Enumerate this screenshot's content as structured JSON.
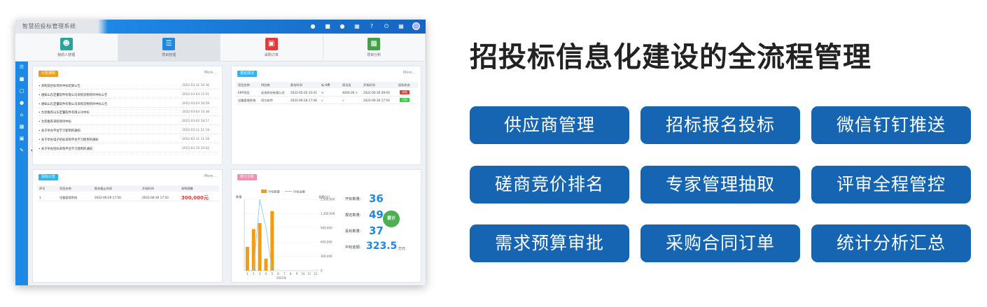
{
  "app": {
    "title": "智慧招投标管理系统",
    "modules": [
      {
        "label": "我的人管理",
        "icon": "user-icon",
        "color": "#26a69a"
      },
      {
        "label": "项目管理",
        "icon": "document-icon",
        "color": "#1e88e5"
      },
      {
        "label": "采购订单",
        "icon": "cart-icon",
        "color": "#e53935"
      },
      {
        "label": "项目分析",
        "icon": "chart-icon",
        "color": "#43a047"
      }
    ],
    "notices": {
      "title": "公告通知",
      "more": "More...",
      "rows": [
        {
          "text": "• 采购及招标项目中标结果公告",
          "date": "2022-03-31 10:36"
        },
        {
          "text": "• 通知山东定量软件有限公司采购货物项目中标公告",
          "date": "2022-03-03 11:01"
        },
        {
          "text": "• 通知山东定量软件有限公司采购货物项目中标公告",
          "date": "2022-03-03 10:59"
        },
        {
          "text": "• 为您推荐山东定量软件有限公司中标",
          "date": "2022-03-03 10:38"
        },
        {
          "text": "• 为您推荐采购项目中标",
          "date": "2022-03-02 18:17"
        },
        {
          "text": "• 关于举办平台学习使用的通知",
          "date": "2022-02-11 11:18"
        },
        {
          "text": "• 关于举办电子招标采购平台学习使用的通知",
          "date": "2022-02-11 11:18"
        },
        {
          "text": "• 关于举办招标采购平台学习使用的通知",
          "date": "2022-02-10 10:02"
        }
      ]
    },
    "bid_status": {
      "title": "报名情况",
      "more": "More...",
      "headers": [
        "项目名称",
        "供应商",
        "报名时间",
        "标书费",
        "保证金",
        "开标时间",
        "投标状态"
      ],
      "rows": [
        {
          "cells": [
            "ERP项目",
            "宏发科技有限公司",
            "2022-05-26 10:41",
            "×",
            "4000.00 ×",
            "2022-06-30 09:00"
          ],
          "status": "未投",
          "status_color": "#e53935"
        },
        {
          "cells": [
            "设备管理系统",
            "同方软件",
            "2022-06-28 17:46",
            "√",
            "√",
            "2022-06-30 17:50"
          ],
          "status": "已投",
          "status_color": "#2ecc40"
        }
      ]
    },
    "tender": {
      "title": "招标公告",
      "more": "More...",
      "headers": [
        "序号",
        "项目名称",
        "报名截止时间",
        "开标时间",
        "采购预算"
      ],
      "row": [
        "1",
        "设备管理系统",
        "2022-06-29 17:50",
        "2022-06-30 17:50",
        "300,000元"
      ]
    },
    "stats": {
      "title": "统计分析",
      "legend_bar": "中标数量",
      "legend_line": "中标金额",
      "y_left_unit": "数量",
      "y_right_unit": "金额(元)",
      "y_right_ticks": [
        "1,500,000",
        "1,200,000",
        "900,000",
        "600,000",
        "300,000",
        "0"
      ],
      "year": "2022年",
      "summary": [
        {
          "label": "开标数量:",
          "value": "36",
          "unit": ""
        },
        {
          "label": "报名数量:",
          "value": "49",
          "unit": ""
        },
        {
          "label": "投标数量:",
          "value": "37",
          "unit": ""
        },
        {
          "label": "中标金额:",
          "value": "323.5",
          "unit": "万元"
        }
      ],
      "total_badge": "累计"
    },
    "chart_data": {
      "type": "bar",
      "categories": [
        "1",
        "2",
        "3",
        "4",
        "5",
        "6",
        "7",
        "8",
        "9",
        "10",
        "11",
        "12"
      ],
      "series": [
        {
          "name": "中标数量",
          "values": [
            2,
            3.5,
            4,
            1,
            5,
            0,
            0,
            0,
            0,
            0,
            0,
            0
          ]
        },
        {
          "name": "中标金额",
          "values": [
            0,
            0,
            1500000,
            900000,
            0,
            0,
            0,
            0,
            0,
            0,
            0,
            0
          ]
        }
      ],
      "xlabel": "2022年",
      "ylabel": "数量",
      "ylim": [
        0,
        6
      ]
    }
  },
  "headline": "招投标信息化建设的全流程管理",
  "features": [
    "供应商管理",
    "招标报名投标",
    "微信钉钉推送",
    "磋商竞价排名",
    "专家管理抽取",
    "评审全程管控",
    "需求预算审批",
    "采购合同订单",
    "统计分析汇总"
  ],
  "colors": {
    "feature_button": "#1565b3",
    "app_blue": "#1e88e5",
    "bar_orange": "#f39c12",
    "budget_red": "#e53935"
  }
}
